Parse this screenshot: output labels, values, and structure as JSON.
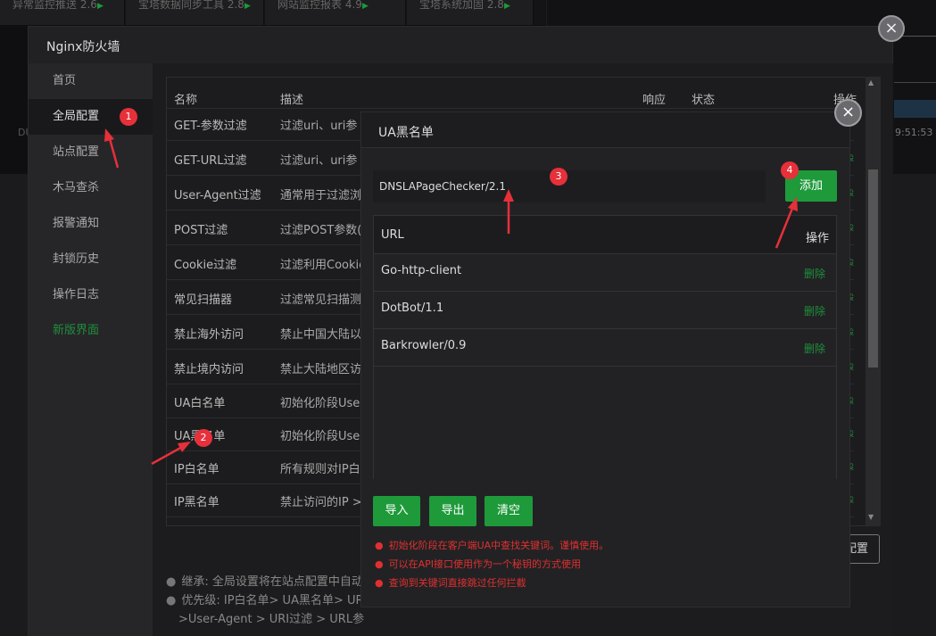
{
  "background": {
    "tabs": [
      {
        "label": "异常监控推送",
        "score": "2.6"
      },
      {
        "label": "宝塔数据同步工具",
        "score": "2.8"
      },
      {
        "label": "网站监控报表",
        "score": "4.9"
      },
      {
        "label": "宝塔系统加固",
        "score": "2.8"
      }
    ],
    "time": "9:51:53",
    "du": "DU"
  },
  "main_modal": {
    "title": "Nginx防火墙",
    "close_label": "×"
  },
  "sidebar": {
    "items": [
      {
        "label": "首页"
      },
      {
        "label": "全局配置"
      },
      {
        "label": "站点配置"
      },
      {
        "label": "木马查杀"
      },
      {
        "label": "报警通知"
      },
      {
        "label": "封锁历史"
      },
      {
        "label": "操作日志"
      },
      {
        "label": "新版界面"
      }
    ],
    "active_index": 1
  },
  "rules_table": {
    "headers": {
      "name": "名称",
      "desc": "描述",
      "response": "响应",
      "status": "状态",
      "action": "操作"
    },
    "rows": [
      {
        "name": "GET-参数过滤",
        "desc": "过滤uri、uri参"
      },
      {
        "name": "GET-URL过滤",
        "desc": "过滤uri、uri参"
      },
      {
        "name": "User-Agent过滤",
        "desc": "通常用于过滤浏"
      },
      {
        "name": "POST过滤",
        "desc": "过滤POST参数("
      },
      {
        "name": "Cookie过滤",
        "desc": "过滤利用Cookie"
      },
      {
        "name": "常见扫描器",
        "desc": "过滤常见扫描测"
      },
      {
        "name": "禁止海外访问",
        "desc": "禁止中国大陆以"
      },
      {
        "name": "禁止境内访问",
        "desc": "禁止大陆地区访"
      },
      {
        "name": "UA白名单",
        "desc": "初始化阶段Use"
      },
      {
        "name": "UA黑名单",
        "desc": "初始化阶段Use"
      },
      {
        "name": "IP白名单",
        "desc": "所有规则对IP白"
      },
      {
        "name": "IP黑名单",
        "desc": "禁止访问的IP >"
      }
    ]
  },
  "config_button": "配置",
  "notes": [
    "继承: 全局设置将在站点配置中自动",
    "优先级: IP白名单> UA黑名单> UR",
    ">User-Agent > URI过滤 > URL参"
  ],
  "ua_dialog": {
    "title": "UA黑名单",
    "close_label": "×",
    "input_value": "DNSLAPageChecker/2.1",
    "add_button": "添加",
    "table_headers": {
      "url": "URL",
      "action": "操作"
    },
    "entries": [
      {
        "url": "Go-http-client",
        "action": "删除"
      },
      {
        "url": "DotBot/1.1",
        "action": "删除"
      },
      {
        "url": "Barkrowler/0.9",
        "action": "删除"
      }
    ],
    "buttons": {
      "import": "导入",
      "export": "导出",
      "clear": "清空"
    },
    "warnings": [
      "初始化阶段在客户端UA中查找关键词。谨慎使用。",
      "可以在API接口使用作为一个秘钥的方式使用",
      "查询到关键词直接跳过任何拦截"
    ]
  },
  "annotations": [
    "1",
    "2",
    "3",
    "4"
  ],
  "colors": {
    "accent_green": "#1e9a3b",
    "annotation_red": "#e6303a",
    "warning_red": "#e03030"
  }
}
